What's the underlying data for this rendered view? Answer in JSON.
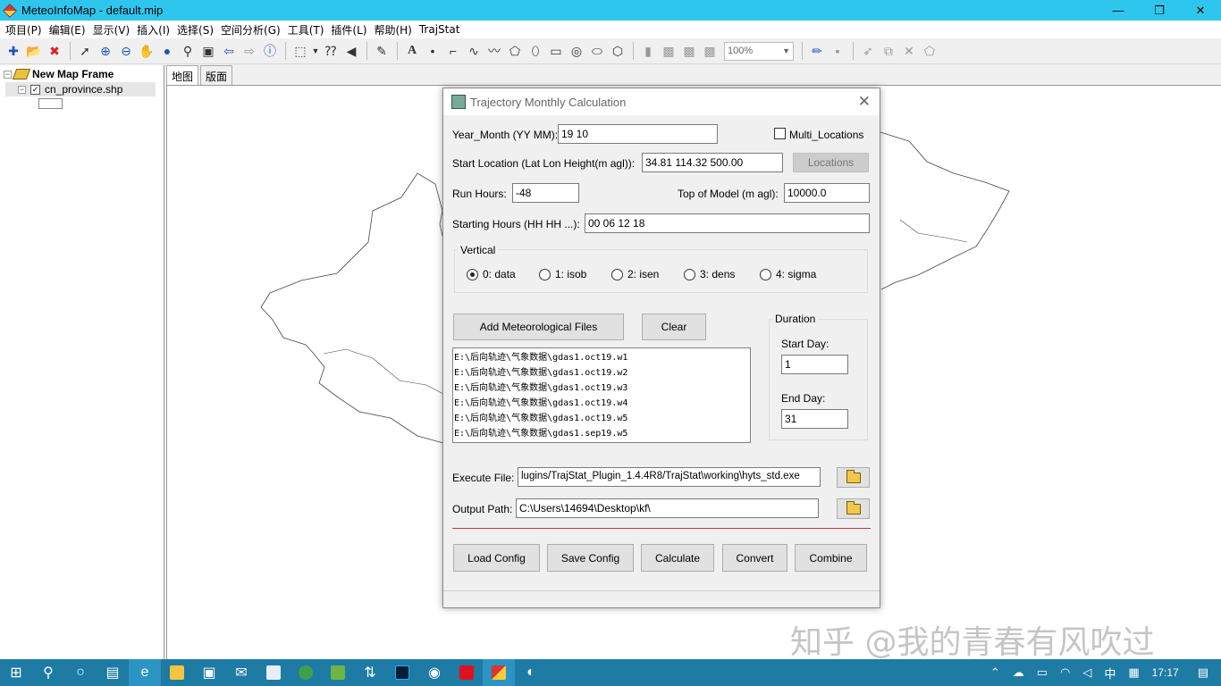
{
  "window": {
    "title": "MeteoInfoMap - default.mip"
  },
  "menu": [
    "项目(P)",
    "编辑(E)",
    "显示(V)",
    "插入(I)",
    "选择(S)",
    "空间分析(G)",
    "工具(T)",
    "插件(L)",
    "帮助(H)",
    "TrajStat"
  ],
  "toolbar": {
    "zoom_value": "100%"
  },
  "tree": {
    "frame_name": "New Map Frame",
    "layer_name": "cn_province.shp"
  },
  "map": {
    "tabs": [
      "地图",
      "版面"
    ]
  },
  "dialog": {
    "title": "Trajectory Monthly Calculation",
    "year_month_label": "Year_Month (YY MM):",
    "year_month_value": "19 10",
    "multi_locations_label": "Multi_Locations",
    "start_location_label": "Start Location (Lat Lon Height(m agl)):",
    "start_location_value": "34.81 114.32 500.00",
    "locations_button": "Locations",
    "run_hours_label": "Run Hours:",
    "run_hours_value": "-48",
    "top_model_label": "Top of Model (m agl):",
    "top_model_value": "10000.0",
    "starting_hours_label": "Starting Hours (HH HH ...):",
    "starting_hours_value": "00 06 12 18",
    "vertical": {
      "legend": "Vertical",
      "options": [
        "0: data",
        "1: isob",
        "2: isen",
        "3: dens",
        "4: sigma"
      ],
      "selected": "0: data"
    },
    "add_files_button": "Add Meteorological Files",
    "clear_button": "Clear",
    "files": [
      "E:\\后向轨迹\\气象数据\\gdas1.oct19.w1",
      "E:\\后向轨迹\\气象数据\\gdas1.oct19.w2",
      "E:\\后向轨迹\\气象数据\\gdas1.oct19.w3",
      "E:\\后向轨迹\\气象数据\\gdas1.oct19.w4",
      "E:\\后向轨迹\\气象数据\\gdas1.oct19.w5",
      "E:\\后向轨迹\\气象数据\\gdas1.sep19.w5"
    ],
    "duration": {
      "legend": "Duration",
      "start_day_label": "Start Day:",
      "start_day_value": "1",
      "end_day_label": "End Day:",
      "end_day_value": "31"
    },
    "execute_file_label": "Execute File:",
    "execute_file_value": "lugins/TrajStat_Plugin_1.4.4R8/TrajStat\\working\\hyts_std.exe",
    "output_path_label": "Output Path:",
    "output_path_value": "C:\\Users\\14694\\Desktop\\kf\\",
    "buttons": {
      "load_config": "Load Config",
      "save_config": "Save Config",
      "calculate": "Calculate",
      "convert": "Convert",
      "combine": "Combine"
    }
  },
  "watermark": "知乎 @我的青春有风吹过",
  "taskbar": {
    "ime": "中",
    "clock": "17:17"
  },
  "colors": {
    "titlebar": "#2fc6ee",
    "taskbar": "#1e7ba4",
    "separator_line": "#cc3333"
  }
}
